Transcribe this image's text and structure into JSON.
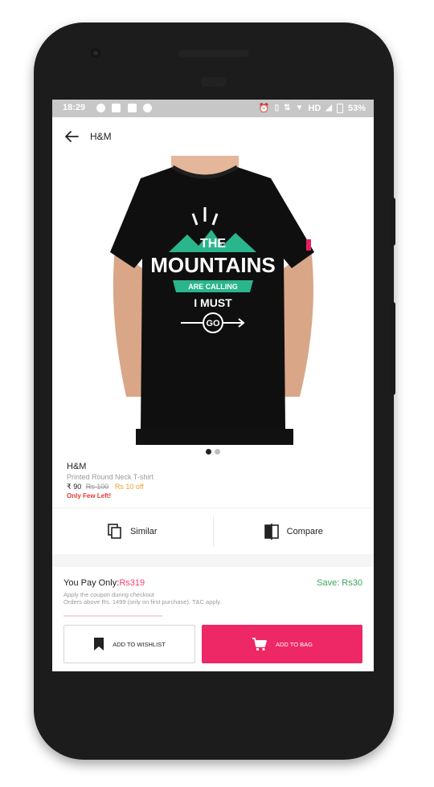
{
  "status_bar": {
    "time": "18:29",
    "hd_label": "HD",
    "battery": "53%"
  },
  "app_bar": {
    "title": "H&M",
    "back_icon": "arrow-left-icon"
  },
  "product": {
    "image_alt": "Black t-shirt with print",
    "print_lines": [
      "THE",
      "MOUNTAINS",
      "ARE CALLING",
      "I MUST",
      "GO"
    ],
    "image_count": 2,
    "active_image_index": 0,
    "brand": "H&M",
    "name": "Printed Round Neck T-shirt",
    "price": "₹ 90",
    "mrp": "Rs 100",
    "discount": "Rs 10 off",
    "stock_note": "Only Few Left!"
  },
  "actions": {
    "similar_label": "Similar",
    "compare_label": "Compare"
  },
  "pay": {
    "you_pay_label": "You Pay Only:",
    "you_pay_value": "Rs319",
    "save_label": "Save: Rs30",
    "coupon_line1": "Apply the coupon during checkout",
    "coupon_line2": "Orders above Rs. 1499 (only on first purchase). T&C apply."
  },
  "buttons": {
    "wishlist_label": "ADD TO WISHLIST",
    "bag_label": "ADD TO BAG"
  },
  "colors": {
    "accent": "#ee2766",
    "save_green": "#3aa55d",
    "discount_orange": "#f0a030",
    "stock_red": "#e53935",
    "teal_print": "#2bb58c"
  }
}
